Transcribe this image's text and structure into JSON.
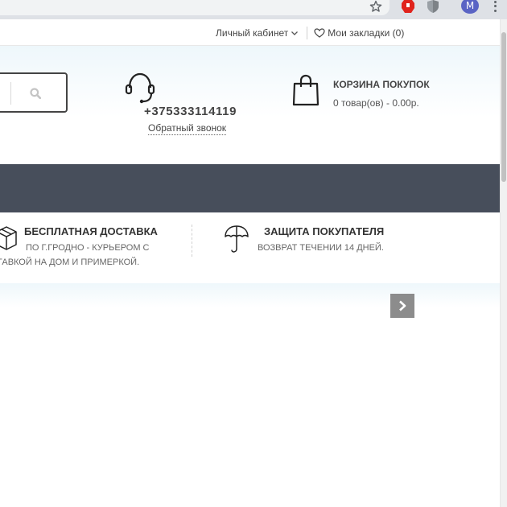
{
  "browser": {
    "avatar_letter": "M",
    "icons": [
      "star-icon",
      "red-extension-icon",
      "shield-extension-icon",
      "kebab-menu-icon"
    ]
  },
  "top_links": {
    "account": "Личный кабинет",
    "bookmarks": "Мои закладки (0)"
  },
  "header": {
    "phone": "+375333114119",
    "callback": "Обратный звонок",
    "cart_title": "КОРЗИНА ПОКУПОК",
    "cart_info": "0 товар(ов) - 0.00р."
  },
  "features": [
    {
      "icon": "box-icon",
      "title": "БЕСПЛАТНАЯ ДОСТАВКА",
      "line1": "ПО Г.ГРОДНО - КУРЬЕРОМ С",
      "line2": "ТАВКОЙ НА ДОМ И ПРИМЕРКОЙ."
    },
    {
      "icon": "umbrella-icon",
      "title": "ЗАЩИТА ПОКУПАТЕЛЯ",
      "line1": "ВОЗВРАТ ТЕЧЕНИИ 14 ДНЕЙ."
    }
  ],
  "colors": {
    "navbar": "#474e5b",
    "text_dark": "#333333",
    "arrow_bg": "#8c8c8c",
    "avatar": "#5a64c4"
  }
}
